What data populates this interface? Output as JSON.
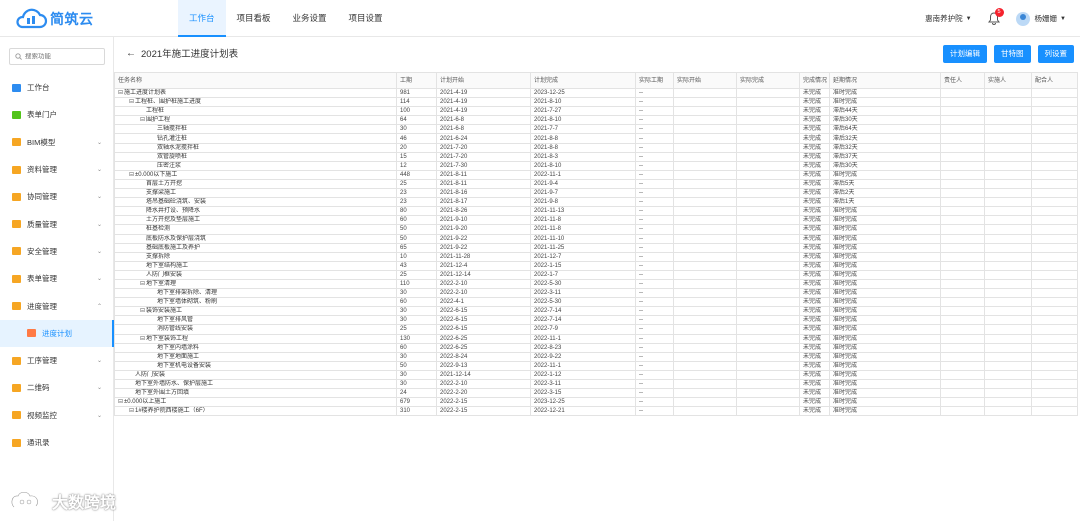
{
  "brand": {
    "name": "简筑云"
  },
  "nav": [
    {
      "label": "工作台",
      "active": true
    },
    {
      "label": "项目看板",
      "active": false
    },
    {
      "label": "业务设置",
      "active": false
    },
    {
      "label": "项目设置",
      "active": false
    }
  ],
  "top_right": {
    "org": "惠南养护院",
    "badge": "5",
    "user": "杨姗姗"
  },
  "search": {
    "placeholder": "搜索功能"
  },
  "sidebar": [
    {
      "label": "工作台",
      "icon": "dashboard-icon",
      "color": "#2d8cf0",
      "arrow": ""
    },
    {
      "label": "表单门户",
      "icon": "form-portal-icon",
      "color": "#52c41a",
      "arrow": ""
    },
    {
      "label": "BIM模型",
      "icon": "folder-icon",
      "color": "#f6a623",
      "arrow": "⌄"
    },
    {
      "label": "资料管理",
      "icon": "folder-icon",
      "color": "#f6a623",
      "arrow": "⌄"
    },
    {
      "label": "协同管理",
      "icon": "folder-icon",
      "color": "#f6a623",
      "arrow": "⌄"
    },
    {
      "label": "质量管理",
      "icon": "folder-icon",
      "color": "#f6a623",
      "arrow": "⌄"
    },
    {
      "label": "安全管理",
      "icon": "folder-icon",
      "color": "#f6a623",
      "arrow": "⌄"
    },
    {
      "label": "表单管理",
      "icon": "folder-icon",
      "color": "#f6a623",
      "arrow": "⌄"
    },
    {
      "label": "进度管理",
      "icon": "folder-icon",
      "color": "#f6a623",
      "arrow": "⌃"
    },
    {
      "label": "进度计划",
      "icon": "calendar-icon",
      "color": "#ff7a45",
      "arrow": "",
      "sub": true
    },
    {
      "label": "工序管理",
      "icon": "folder-icon",
      "color": "#f6a623",
      "arrow": "⌄"
    },
    {
      "label": "二维码",
      "icon": "folder-icon",
      "color": "#f6a623",
      "arrow": "⌄"
    },
    {
      "label": "视频监控",
      "icon": "folder-icon",
      "color": "#f6a623",
      "arrow": "⌄"
    },
    {
      "label": "通讯录",
      "icon": "contacts-icon",
      "color": "#f6a623",
      "arrow": ""
    }
  ],
  "page": {
    "title": "2021年施工进度计划表",
    "buttons": [
      "计划编辑",
      "甘特图",
      "列设置"
    ]
  },
  "table": {
    "columns": [
      "任务名称",
      "工期",
      "计划开始",
      "计划完成",
      "实际工期",
      "实际开始",
      "实际完成",
      "完成情况",
      "延期情况",
      "责任人",
      "实施人",
      "配合人"
    ],
    "rows": [
      {
        "level": 0,
        "toggle": "⊟",
        "name": "施工进度计划表",
        "dur": "981",
        "start": "2021-4-19",
        "end": "2023-12-25",
        "adur": "--",
        "status": "未完成",
        "delay": "准时完成"
      },
      {
        "level": 1,
        "toggle": "⊟",
        "name": "工程桩、围护桩施工进度",
        "dur": "114",
        "start": "2021-4-19",
        "end": "2021-8-10",
        "adur": "--",
        "status": "未完成",
        "delay": "准时完成"
      },
      {
        "level": 2,
        "toggle": "",
        "name": "工程桩",
        "dur": "100",
        "start": "2021-4-19",
        "end": "2021-7-27",
        "adur": "--",
        "status": "未完成",
        "delay": "滞后44天"
      },
      {
        "level": 2,
        "toggle": "⊟",
        "name": "围护工程",
        "dur": "64",
        "start": "2021-6-8",
        "end": "2021-8-10",
        "adur": "--",
        "status": "未完成",
        "delay": "滞后30天"
      },
      {
        "level": 3,
        "toggle": "",
        "name": "三轴搅拌桩",
        "dur": "30",
        "start": "2021-6-8",
        "end": "2021-7-7",
        "adur": "--",
        "status": "未完成",
        "delay": "滞后64天"
      },
      {
        "level": 3,
        "toggle": "",
        "name": "钻孔灌注桩",
        "dur": "46",
        "start": "2021-6-24",
        "end": "2021-8-8",
        "adur": "--",
        "status": "未完成",
        "delay": "滞后32天"
      },
      {
        "level": 3,
        "toggle": "",
        "name": "双轴水泥搅拌桩",
        "dur": "20",
        "start": "2021-7-20",
        "end": "2021-8-8",
        "adur": "--",
        "status": "未完成",
        "delay": "滞后32天"
      },
      {
        "level": 3,
        "toggle": "",
        "name": "双管旋喷桩",
        "dur": "15",
        "start": "2021-7-20",
        "end": "2021-8-3",
        "adur": "--",
        "status": "未完成",
        "delay": "滞后37天"
      },
      {
        "level": 3,
        "toggle": "",
        "name": "压密注浆",
        "dur": "12",
        "start": "2021-7-30",
        "end": "2021-8-10",
        "adur": "--",
        "status": "未完成",
        "delay": "滞后30天"
      },
      {
        "level": 1,
        "toggle": "⊟",
        "name": "±0.000以下施工",
        "dur": "448",
        "start": "2021-8-11",
        "end": "2022-11-1",
        "adur": "--",
        "status": "未完成",
        "delay": "准时完成"
      },
      {
        "level": 2,
        "toggle": "",
        "name": "首层土方开挖",
        "dur": "25",
        "start": "2021-8-11",
        "end": "2021-9-4",
        "adur": "--",
        "status": "未完成",
        "delay": "滞后5天"
      },
      {
        "level": 2,
        "toggle": "",
        "name": "支撑梁施工",
        "dur": "23",
        "start": "2021-8-16",
        "end": "2021-9-7",
        "adur": "--",
        "status": "未完成",
        "delay": "滞后2天"
      },
      {
        "level": 2,
        "toggle": "",
        "name": "塔吊基础砼浇筑、安装",
        "dur": "23",
        "start": "2021-8-17",
        "end": "2021-9-8",
        "adur": "--",
        "status": "未完成",
        "delay": "滞后1天"
      },
      {
        "level": 2,
        "toggle": "",
        "name": "降水井打设、预降水",
        "dur": "80",
        "start": "2021-8-26",
        "end": "2021-11-13",
        "adur": "--",
        "status": "未完成",
        "delay": "准时完成"
      },
      {
        "level": 2,
        "toggle": "",
        "name": "土方开挖及垫层施工",
        "dur": "60",
        "start": "2021-9-10",
        "end": "2021-11-8",
        "adur": "--",
        "status": "未完成",
        "delay": "准时完成"
      },
      {
        "level": 2,
        "toggle": "",
        "name": "桩基检测",
        "dur": "50",
        "start": "2021-9-20",
        "end": "2021-11-8",
        "adur": "--",
        "status": "未完成",
        "delay": "准时完成"
      },
      {
        "level": 2,
        "toggle": "",
        "name": "底板防水及保护层浇筑",
        "dur": "50",
        "start": "2021-9-22",
        "end": "2021-11-10",
        "adur": "--",
        "status": "未完成",
        "delay": "准时完成"
      },
      {
        "level": 2,
        "toggle": "",
        "name": "基础底板施工及养护",
        "dur": "65",
        "start": "2021-9-22",
        "end": "2021-11-25",
        "adur": "--",
        "status": "未完成",
        "delay": "准时完成"
      },
      {
        "level": 2,
        "toggle": "",
        "name": "支撑拆除",
        "dur": "10",
        "start": "2021-11-28",
        "end": "2021-12-7",
        "adur": "--",
        "status": "未完成",
        "delay": "准时完成"
      },
      {
        "level": 2,
        "toggle": "",
        "name": "地下室结构施工",
        "dur": "43",
        "start": "2021-12-4",
        "end": "2022-1-15",
        "adur": "--",
        "status": "未完成",
        "delay": "准时完成"
      },
      {
        "level": 2,
        "toggle": "",
        "name": "人防门框安装",
        "dur": "25",
        "start": "2021-12-14",
        "end": "2022-1-7",
        "adur": "--",
        "status": "未完成",
        "delay": "准时完成"
      },
      {
        "level": 2,
        "toggle": "⊟",
        "name": "地下室清理",
        "dur": "110",
        "start": "2022-2-10",
        "end": "2022-5-30",
        "adur": "--",
        "status": "未完成",
        "delay": "准时完成"
      },
      {
        "level": 3,
        "toggle": "",
        "name": "地下室排架拆除、清理",
        "dur": "30",
        "start": "2022-2-10",
        "end": "2022-3-11",
        "adur": "--",
        "status": "未完成",
        "delay": "准时完成"
      },
      {
        "level": 3,
        "toggle": "",
        "name": "地下室墙体砌筑、粉刷",
        "dur": "60",
        "start": "2022-4-1",
        "end": "2022-5-30",
        "adur": "--",
        "status": "未完成",
        "delay": "准时完成"
      },
      {
        "level": 2,
        "toggle": "⊟",
        "name": "装饰安装施工",
        "dur": "30",
        "start": "2022-6-15",
        "end": "2022-7-14",
        "adur": "--",
        "status": "未完成",
        "delay": "准时完成"
      },
      {
        "level": 3,
        "toggle": "",
        "name": "地下室排风管",
        "dur": "30",
        "start": "2022-6-15",
        "end": "2022-7-14",
        "adur": "--",
        "status": "未完成",
        "delay": "准时完成"
      },
      {
        "level": 3,
        "toggle": "",
        "name": "消防管线安装",
        "dur": "25",
        "start": "2022-6-15",
        "end": "2022-7-9",
        "adur": "--",
        "status": "未完成",
        "delay": "准时完成"
      },
      {
        "level": 2,
        "toggle": "⊟",
        "name": "地下室装饰工程",
        "dur": "130",
        "start": "2022-6-25",
        "end": "2022-11-1",
        "adur": "--",
        "status": "未完成",
        "delay": "准时完成"
      },
      {
        "level": 3,
        "toggle": "",
        "name": "地下室内墙涂料",
        "dur": "60",
        "start": "2022-6-25",
        "end": "2022-8-23",
        "adur": "--",
        "status": "未完成",
        "delay": "准时完成"
      },
      {
        "level": 3,
        "toggle": "",
        "name": "地下室地面施工",
        "dur": "30",
        "start": "2022-8-24",
        "end": "2022-9-22",
        "adur": "--",
        "status": "未完成",
        "delay": "准时完成"
      },
      {
        "level": 3,
        "toggle": "",
        "name": "地下室机电设备安装",
        "dur": "50",
        "start": "2022-9-13",
        "end": "2022-11-1",
        "adur": "--",
        "status": "未完成",
        "delay": "准时完成"
      },
      {
        "level": 1,
        "toggle": "",
        "name": "人防门安装",
        "dur": "30",
        "start": "2021-12-14",
        "end": "2022-1-12",
        "adur": "--",
        "status": "未完成",
        "delay": "准时完成"
      },
      {
        "level": 1,
        "toggle": "",
        "name": "地下室外墙防水、保护层施工",
        "dur": "30",
        "start": "2022-2-10",
        "end": "2022-3-11",
        "adur": "--",
        "status": "未完成",
        "delay": "准时完成"
      },
      {
        "level": 1,
        "toggle": "",
        "name": "地下室外围土方回填",
        "dur": "24",
        "start": "2022-2-20",
        "end": "2022-3-15",
        "adur": "--",
        "status": "未完成",
        "delay": "准时完成"
      },
      {
        "level": 0,
        "toggle": "⊟",
        "name": "±0.000以上施工",
        "dur": "679",
        "start": "2022-2-15",
        "end": "2023-12-25",
        "adur": "--",
        "status": "未完成",
        "delay": "准时完成"
      },
      {
        "level": 1,
        "toggle": "⊟",
        "name": "1#楼养护院西楼施工（6F）",
        "dur": "310",
        "start": "2022-2-15",
        "end": "2022-12-21",
        "adur": "--",
        "status": "未完成",
        "delay": "准时完成"
      }
    ]
  },
  "watermark": {
    "text": "大数跨境"
  },
  "colors": {
    "accent": "#1890ff",
    "badge": "#f5222d"
  }
}
